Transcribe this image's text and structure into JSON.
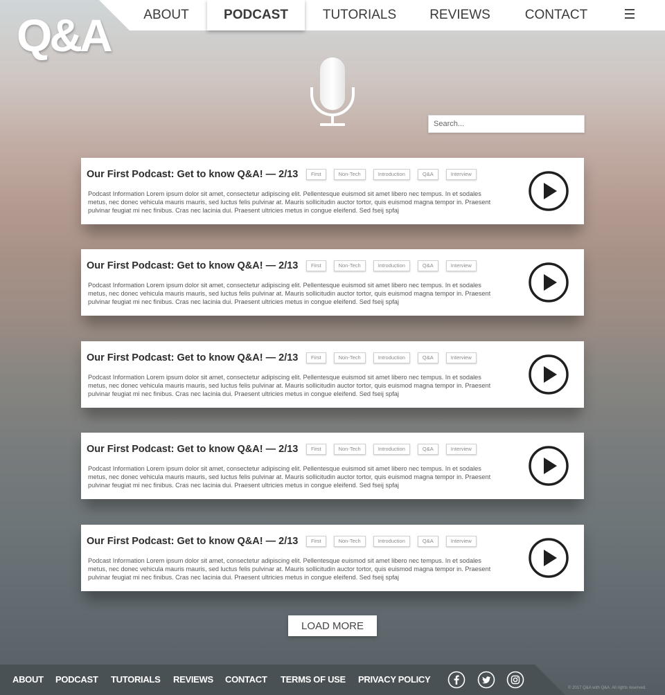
{
  "brand": {
    "logo_text": "Q&A"
  },
  "nav": {
    "items": [
      {
        "label": "ABOUT",
        "active": false
      },
      {
        "label": "PODCAST",
        "active": true
      },
      {
        "label": "TUTORIALS",
        "active": false
      },
      {
        "label": "REVIEWS",
        "active": false
      },
      {
        "label": "CONTACT",
        "active": false
      }
    ],
    "menu_icon": "hamburger-icon"
  },
  "hero": {
    "icon": "microphone-icon"
  },
  "search": {
    "placeholder": "Search..."
  },
  "podcasts": [
    {
      "title": "Our First Podcast: Get to know Q&A! — 2/13",
      "tags": [
        "First",
        "Non-Tech",
        "Introduction",
        "Q&A",
        "Interview"
      ],
      "description": "Podcast Information Lorem ipsum dolor sit amet, consectetur adipiscing elit. Pellentesque euismod sit amet libero nec tempus. In et sodales metus, nec donec vehicula mauris mauris, sed luctus felis pulvinar at. Mauris sollicitudin auctor tortor, quis euismod magna tempor in. Praesent pulvinar feugiat mi nec finibus. Cras nec lacinia dui. Praesent ultricies metus in congue eleifend. Sed fseij spfaj"
    },
    {
      "title": "Our First Podcast: Get to know Q&A! — 2/13",
      "tags": [
        "First",
        "Non-Tech",
        "Introduction",
        "Q&A",
        "Interview"
      ],
      "description": "Podcast Information Lorem ipsum dolor sit amet, consectetur adipiscing elit. Pellentesque euismod sit amet libero nec tempus. In et sodales metus, nec donec vehicula mauris mauris, sed luctus felis pulvinar at. Mauris sollicitudin auctor tortor, quis euismod magna tempor in. Praesent pulvinar feugiat mi nec finibus. Cras nec lacinia dui. Praesent ultricies metus in congue eleifend. Sed fseij spfaj"
    },
    {
      "title": "Our First Podcast: Get to know Q&A! — 2/13",
      "tags": [
        "First",
        "Non-Tech",
        "Introduction",
        "Q&A",
        "Interview"
      ],
      "description": "Podcast Information Lorem ipsum dolor sit amet, consectetur adipiscing elit. Pellentesque euismod sit amet libero nec tempus. In et sodales metus, nec donec vehicula mauris mauris, sed luctus felis pulvinar at. Mauris sollicitudin auctor tortor, quis euismod magna tempor in. Praesent pulvinar feugiat mi nec finibus. Cras nec lacinia dui. Praesent ultricies metus in congue eleifend. Sed fseij spfaj"
    },
    {
      "title": "Our First Podcast: Get to know Q&A! — 2/13",
      "tags": [
        "First",
        "Non-Tech",
        "Introduction",
        "Q&A",
        "Interview"
      ],
      "description": "Podcast Information Lorem ipsum dolor sit amet, consectetur adipiscing elit. Pellentesque euismod sit amet libero nec tempus. In et sodales metus, nec donec vehicula mauris mauris, sed luctus felis pulvinar at. Mauris sollicitudin auctor tortor, quis euismod magna tempor in. Praesent pulvinar feugiat mi nec finibus. Cras nec lacinia dui. Praesent ultricies metus in congue eleifend. Sed fseij spfaj"
    },
    {
      "title": "Our First Podcast: Get to know Q&A! — 2/13",
      "tags": [
        "First",
        "Non-Tech",
        "Introduction",
        "Q&A",
        "Interview"
      ],
      "description": "Podcast Information Lorem ipsum dolor sit amet, consectetur adipiscing elit. Pellentesque euismod sit amet libero nec tempus. In et sodales metus, nec donec vehicula mauris mauris, sed luctus felis pulvinar at. Mauris sollicitudin auctor tortor, quis euismod magna tempor in. Praesent pulvinar feugiat mi nec finibus. Cras nec lacinia dui. Praesent ultricies metus in congue eleifend. Sed fseij spfaj"
    }
  ],
  "play_icon": "play-icon",
  "load_more": {
    "label": "LOAD MORE"
  },
  "footer": {
    "links": [
      "ABOUT",
      "PODCAST",
      "TUTORIALS",
      "REVIEWS",
      "CONTACT",
      "TERMS OF USE",
      "PRIVACY POLICY"
    ],
    "social": [
      "facebook-icon",
      "twitter-icon",
      "instagram-icon"
    ],
    "copyright": "© 2017 Q&A with Q&A. All rights reserved."
  },
  "colors": {
    "card_bg": "#ffffff",
    "footer_bg": "#4a5155",
    "text_dark": "#2c2c2c"
  }
}
